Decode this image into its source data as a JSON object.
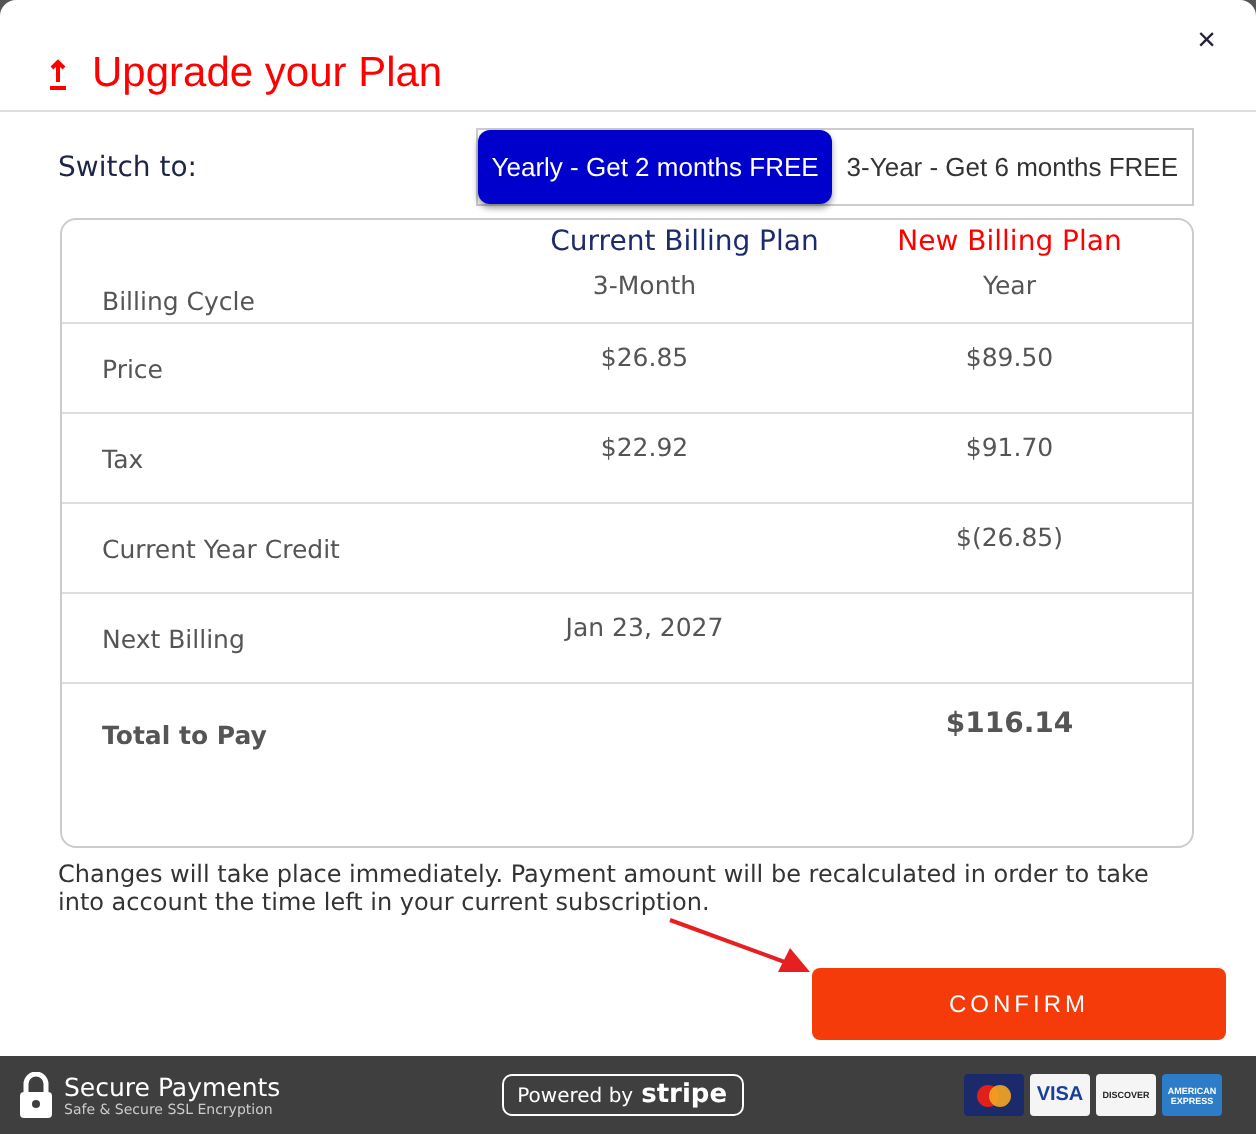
{
  "dialog": {
    "title": "Upgrade your Plan",
    "close": "×"
  },
  "switch": {
    "label": "Switch to:",
    "options": [
      {
        "label": "Yearly - Get 2 months FREE",
        "selected": true
      },
      {
        "label": "3-Year - Get 6 months FREE",
        "selected": false
      }
    ]
  },
  "table": {
    "columns": [
      "Current Billing Plan",
      "New Billing Plan"
    ],
    "rows": [
      {
        "label": "Billing Cycle",
        "current": "3-Month",
        "new": "Year",
        "bold": false
      },
      {
        "label": "Price",
        "current": "$26.85",
        "new": "$89.50",
        "bold": false
      },
      {
        "label": "Tax",
        "current": "$22.92",
        "new": "$91.70",
        "bold": false
      },
      {
        "label": "Current Year Credit",
        "current": "",
        "new": "$(26.85)",
        "bold": false
      },
      {
        "label": "Next Billing",
        "current": "Jan 23, 2027",
        "new": "",
        "bold": false
      },
      {
        "label": "Total to Pay",
        "current": "",
        "new": "$116.14",
        "bold": true
      }
    ]
  },
  "note": "Changes will take place immediately. Payment amount will be recalculated in order to take into account the time left in your current subscription.",
  "confirm": "CONFIRM",
  "footer": {
    "title": "Secure Payments",
    "subtitle": "Safe & Secure SSL Encryption",
    "powered": "Powered by",
    "brand": "stripe",
    "cards": [
      {
        "kind": "mastercard"
      },
      {
        "kind": "visa",
        "label": "VISA"
      },
      {
        "kind": "discover",
        "label": "DISCOVER"
      },
      {
        "kind": "amex",
        "label": "AMERICAN EXPRESS"
      }
    ]
  }
}
